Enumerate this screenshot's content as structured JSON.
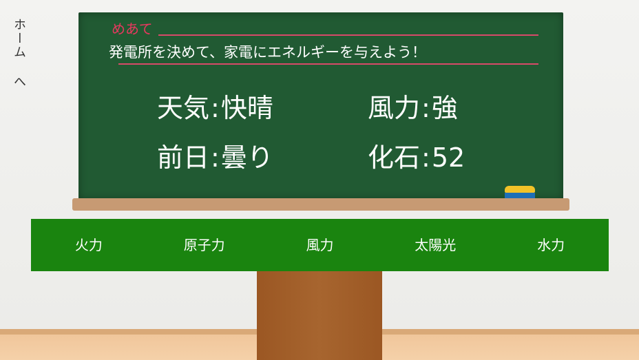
{
  "nav": {
    "home_label": "ホーム へ"
  },
  "board": {
    "goal_label": "めあて",
    "goal_text": "発電所を決めて、家電にエネルギーを与えよう！"
  },
  "stats": {
    "weather": {
      "label": "天気",
      "value": "快晴"
    },
    "wind": {
      "label": "風力",
      "value": "強"
    },
    "yesterday": {
      "label": "前日",
      "value": "曇り"
    },
    "fossil": {
      "label": "化石",
      "value": "52"
    }
  },
  "menu": {
    "items": [
      {
        "label": "火力"
      },
      {
        "label": "原子力"
      },
      {
        "label": "風力"
      },
      {
        "label": "太陽光"
      },
      {
        "label": "水力"
      }
    ]
  },
  "colors": {
    "board": "#215a33",
    "menu": "#1a840f",
    "goal_accent": "#e9385f"
  }
}
